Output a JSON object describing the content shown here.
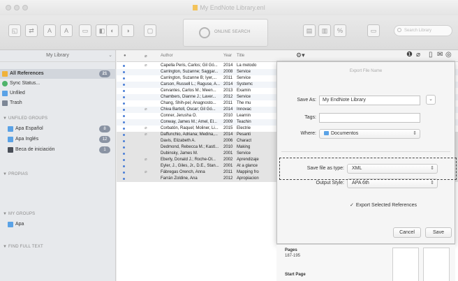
{
  "window": {
    "title": "My EndNote Library.enl"
  },
  "toolbar": {
    "online_label": "ONLINE SEARCH",
    "search_placeholder": "Search Library"
  },
  "sidebar": {
    "header": "My Library",
    "items": [
      {
        "label": "All References",
        "count": "21"
      },
      {
        "label": "Sync Status..."
      },
      {
        "label": "Unfiled"
      },
      {
        "label": "Trash"
      }
    ],
    "groups": [
      {
        "title": "UNFILED GROUPS",
        "items": [
          {
            "label": "Apa Español",
            "count": "8"
          },
          {
            "label": "Apa Inglés",
            "count": "12"
          },
          {
            "label": "Beca de iniciación",
            "count": "1"
          }
        ]
      },
      {
        "title": "PROPIAS",
        "items": []
      },
      {
        "title": "MY GROUPS",
        "items": [
          {
            "label": "Apa"
          }
        ]
      },
      {
        "title": "FIND FULL TEXT",
        "items": []
      }
    ]
  },
  "list": {
    "columns": {
      "author": "Author",
      "year": "Year",
      "title": "Title"
    },
    "rows": [
      {
        "author": "Capella Peris, Carlos; Gil Gó...",
        "year": "2014",
        "title": "La metodo",
        "clip": true
      },
      {
        "author": "Carrington, Suzanne; Saggar...",
        "year": "2008",
        "title": "Service"
      },
      {
        "author": "Carrington, Suzanne B; Iyer,...",
        "year": "2011",
        "title": "Service"
      },
      {
        "author": "Carson, Russell L.; Raguse, A...",
        "year": "2014",
        "title": "Systemc"
      },
      {
        "author": "Cervantes, Carlos M.; Meen...",
        "year": "2013",
        "title": "Examin"
      },
      {
        "author": "Chambers, Dianne J.; Laver...",
        "year": "2012",
        "title": "Service"
      },
      {
        "author": "Chang, Shih-pei; Anagnosto...",
        "year": "2011",
        "title": "The mu"
      },
      {
        "author": "Chiva Bartoll, Oscar; Gil Gó...",
        "year": "2014",
        "title": "Innovac",
        "clip": true
      },
      {
        "author": "Conner, Jerusha O.",
        "year": "2010",
        "title": "Learnin"
      },
      {
        "author": "Conway, James M.; Amel, El...",
        "year": "2009",
        "title": "Teachin"
      },
      {
        "author": "Corbatón, Raquel; Moliner, Li...",
        "year": "2015",
        "title": "Electrie",
        "clip": true
      },
      {
        "author": "Daffunchio, Adriana; Medina,...",
        "year": "2014",
        "title": "Pesanti",
        "clip": true
      },
      {
        "author": "Davis, Elizabeth A.",
        "year": "2006",
        "title": "Charact"
      },
      {
        "author": "Dedmond, Rebecca M.; Kastl...",
        "year": "2010",
        "title": "Making"
      },
      {
        "author": "Dubinsky, James M.",
        "year": "2001",
        "title": "Service"
      },
      {
        "author": "Eberly, Donald J.; Roche-Ol...",
        "year": "2002",
        "title": "Aprendizaje",
        "clip": true
      },
      {
        "author": "Eyler, J., Giles, Jr., D.E., Stan...",
        "year": "2001",
        "title": "At a glance"
      },
      {
        "author": "Fábregas Orench, Anna",
        "year": "2011",
        "title": "Mapping fro",
        "clip": true
      },
      {
        "author": "Farrán Zoldine, Ana",
        "year": "2012",
        "title": "Apropiacion"
      }
    ]
  },
  "export_sheet": {
    "title": "Export File Name",
    "save_as_label": "Save As:",
    "save_as_value": "My EndNote Library",
    "tags_label": "Tags:",
    "tags_value": "",
    "where_label": "Where:",
    "where_value": "Documentos",
    "save_type_label": "Save file as type:",
    "save_type_value": "XML",
    "output_style_label": "Output Style:",
    "output_style_value": "APA 6th",
    "export_selected_label": "Export Selected References",
    "export_selected_checked": true,
    "cancel_label": "Cancel",
    "save_label": "Save"
  },
  "preview": {
    "pages_label": "Pages",
    "pages_value": "187-195",
    "start_page_label": "Start Page"
  },
  "colors": {
    "accent": "#4a7ed6",
    "badge": "#8a93a3",
    "folder": "#5aa2e6"
  }
}
